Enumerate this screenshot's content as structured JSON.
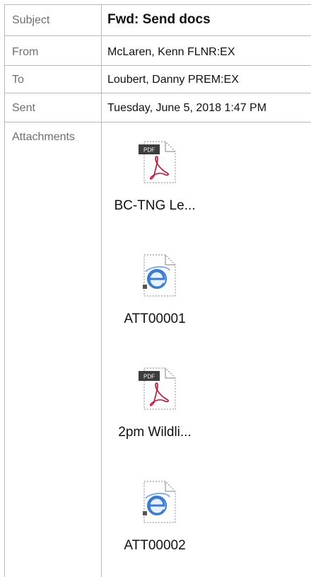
{
  "header_fields": {
    "subject_label": "Subject",
    "subject_value": "Fwd: Send docs",
    "from_label": "From",
    "from_value": "McLaren, Kenn FLNR:EX",
    "to_label": "To",
    "to_value": "Loubert, Danny PREM:EX",
    "sent_label": "Sent",
    "sent_value": "Tuesday, June 5, 2018 1:47 PM",
    "attachments_label": "Attachments"
  },
  "attachments": [
    {
      "name": "BC-TNG Le...",
      "icon": "pdf-file-icon",
      "badge": "PDF"
    },
    {
      "name": "ATT00001",
      "icon": "html-file-icon"
    },
    {
      "name": "2pm Wildli...",
      "icon": "pdf-file-icon",
      "badge": "PDF"
    },
    {
      "name": "ATT00002",
      "icon": "html-file-icon"
    }
  ],
  "colors": {
    "border": "#b9b9b9",
    "label_text": "#6f6f6f",
    "pdf_red": "#c8102e",
    "ie_blue": "#3a7bd5"
  }
}
